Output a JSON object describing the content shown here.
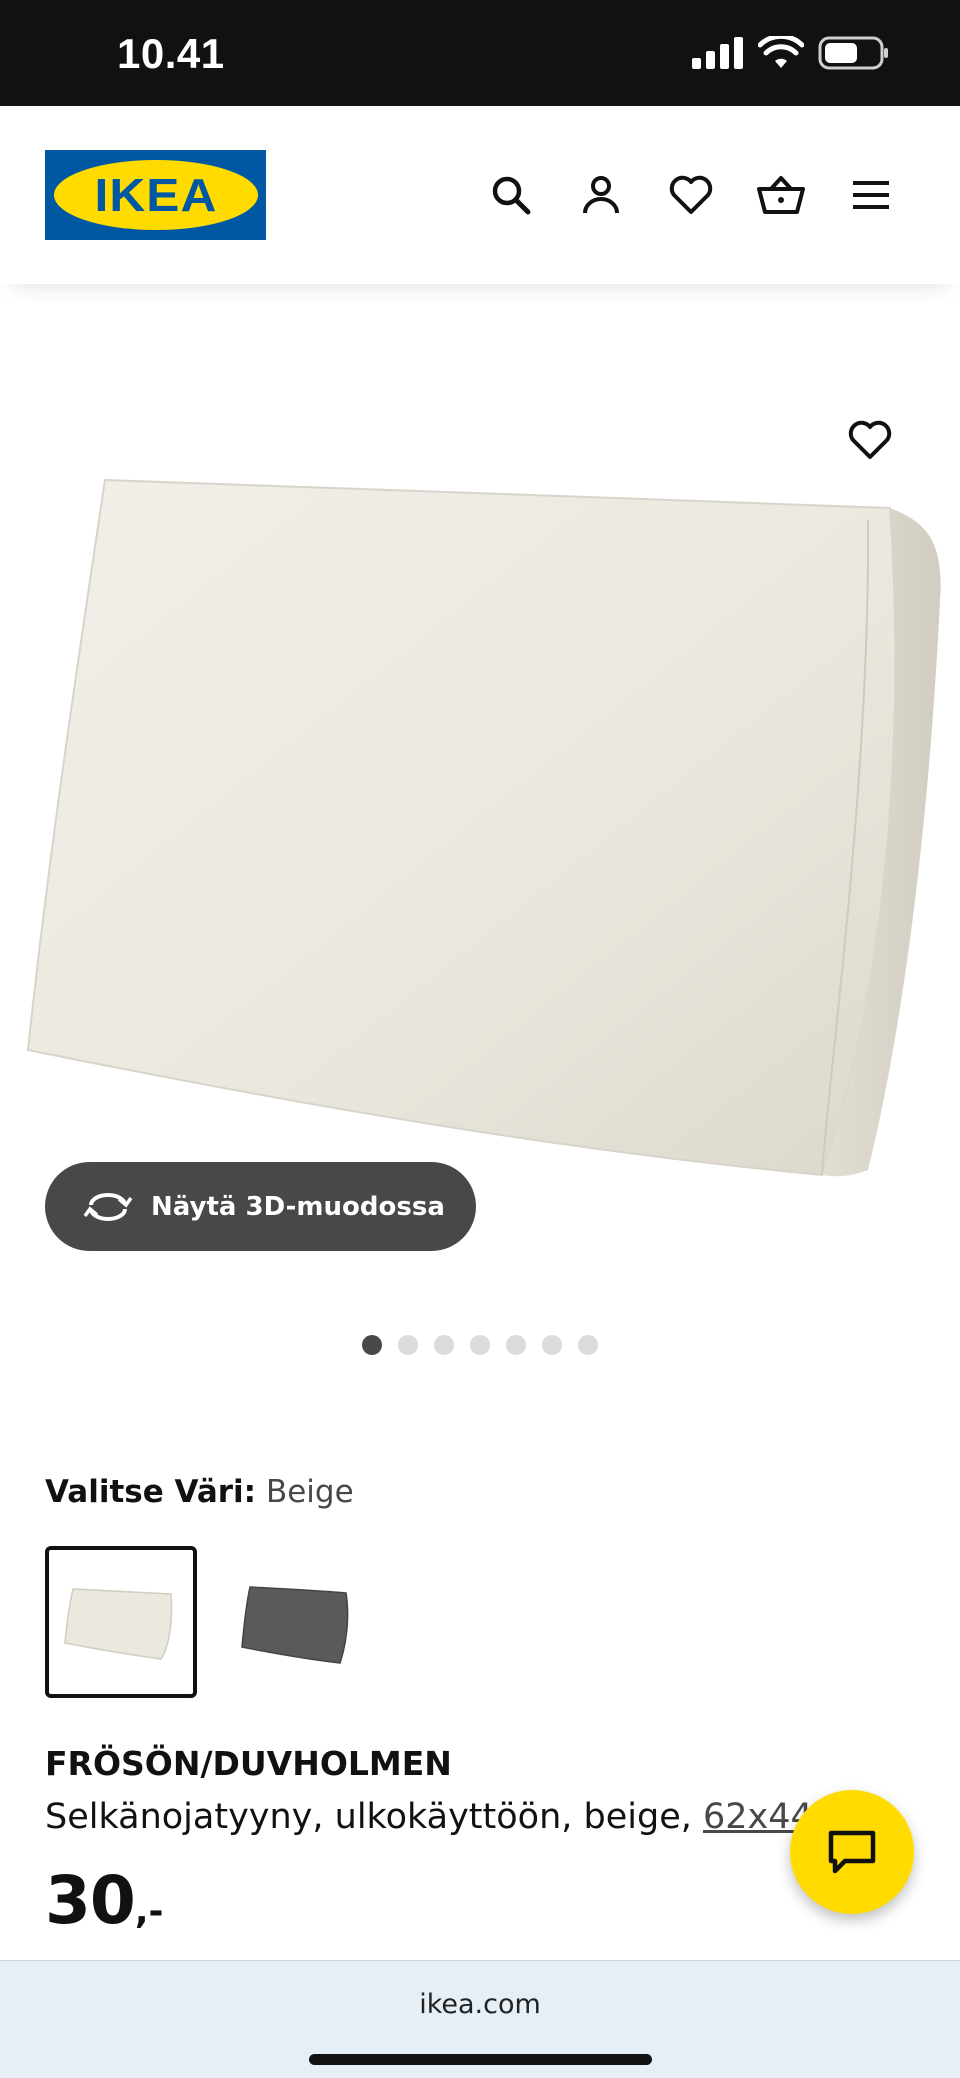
{
  "status_bar": {
    "time": "10.41",
    "icons": [
      "cellular-signal-icon",
      "wifi-icon",
      "battery-icon"
    ]
  },
  "header": {
    "logo_text": "IKEA",
    "icons": [
      "search-icon",
      "user-icon",
      "heart-icon",
      "basket-icon",
      "menu-icon"
    ]
  },
  "gallery": {
    "view_3d_label": "Näytä 3D-muodossa",
    "slide_count": 7,
    "active_slide": 1
  },
  "color_selection": {
    "label": "Valitse Väri:",
    "value": "Beige",
    "options": [
      "Beige",
      "Dark grey"
    ]
  },
  "product": {
    "name": "FRÖSÖN/DUVHOLMEN",
    "description": "Selkänojatyyny, ulkokäyttöön, beige,",
    "size_link": "62x44 cm",
    "price_integer": "30",
    "price_decimal": ",-"
  },
  "browser": {
    "url": "ikea.com"
  },
  "colors": {
    "brand_blue": "#0058a3",
    "brand_yellow": "#ffdb00",
    "pill_dark": "#484848"
  }
}
